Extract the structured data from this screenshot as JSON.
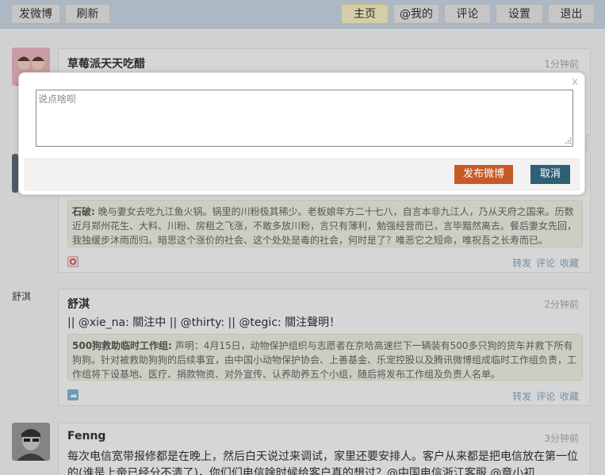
{
  "topbar": {
    "left_buttons": [
      "发微博",
      "刷新"
    ],
    "right_buttons": [
      "主页",
      "@我的",
      "评论",
      "设置",
      "退出"
    ],
    "active": "主页"
  },
  "posts": [
    {
      "user": "草莓派天天吃醋",
      "time": "1分钟前"
    },
    {
      "repost_author": "石破:",
      "repost_text": "晚与妻女去吃九江鱼火锅。锅里的川粉极其稀少。老板娘年方二十七八，自言本非九江人，乃从天府之国来。历数近月郑州花生、大料、川粉、房租之飞涨，不敢多放川粉，言只有薄利，勉强经营而已，言毕黯然离去。餐后妻女先回，我独缓步沐雨而归。暗思这个涨价的社会、这个处处是毒的社会，何时是了？唯恶它之短命，唯祝吾之长寿而已。",
      "actions": [
        "转发",
        "评论",
        "收藏"
      ]
    },
    {
      "side_name": "舒淇",
      "user": "舒淇",
      "time": "2分钟前",
      "text": "|| @xie_na: 關注中 || @thirty: || @tegic: 關注聲明！",
      "repost_author": "500狗救助临时工作组:",
      "repost_text": "声明：4月15日，动物保护组织与志愿者在京哈高速拦下一辆装有500多只狗的货车并救下所有狗狗。针对被救助狗狗的后续事宜，由中国小动物保护协会、上善基金、乐宠控股以及腾讯微博组成临时工作组负责，工作组将下设基地、医疗、捐款物资、对外宣传、认养助养五个小组，随后将发布工作组及负责人名单。",
      "actions": [
        "转发",
        "评论",
        "收藏"
      ]
    },
    {
      "user": "Fenng",
      "time": "3分钟前",
      "text": "每次电信宽带报修都是在晚上，然后白天说过来调试，家里还要安排人。客户从来都是把电信放在第一位的(谁是上帝已经分不清了)，你们们电信啥时候给客户真的想过？@中国电信浙江客服 @章小初"
    }
  ],
  "compose": {
    "close": "x",
    "placeholder": "说点啥呗",
    "value": "",
    "publish": "发布微博",
    "cancel": "取消"
  },
  "colors": {
    "topbar_bg": "#c9d8e6",
    "active_tab": "#f6efc4",
    "publish_btn": "#c65a27",
    "cancel_btn": "#2e5f74",
    "link": "#8aa5bd"
  }
}
